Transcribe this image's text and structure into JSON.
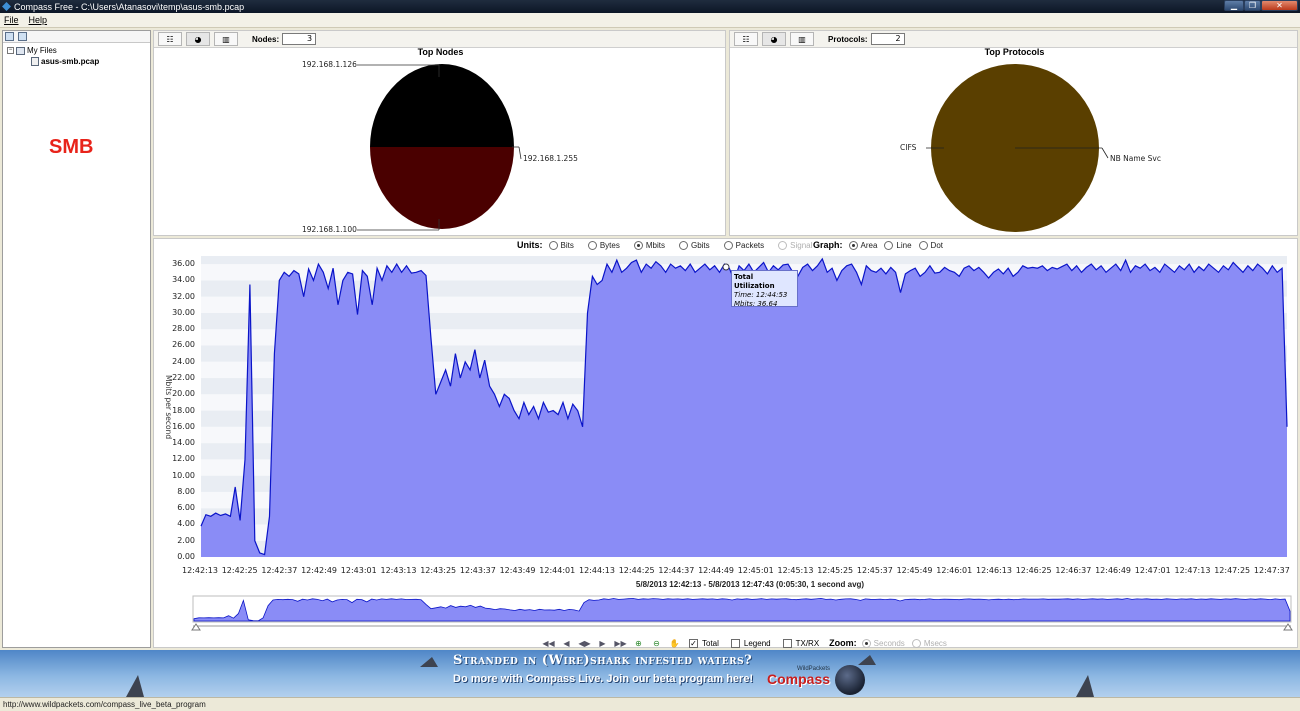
{
  "window": {
    "title": "Compass Free - C:\\Users\\Atanasovi\\temp\\asus-smb.pcap"
  },
  "menu": [
    {
      "label": "File"
    },
    {
      "label": "Help"
    }
  ],
  "tree": {
    "root_label": "My Files",
    "file_label": "asus-smb.pcap",
    "annotation": "SMB"
  },
  "nodes_panel": {
    "count_label": "Nodes:",
    "count_value": "3",
    "title": "Top Nodes",
    "slices": [
      {
        "label": "192.168.1.126",
        "fraction": 0.5,
        "color": "#000000"
      },
      {
        "label": "192.168.1.255",
        "fraction": 0.0,
        "color": "#4a0000"
      },
      {
        "label": "192.168.1.100",
        "fraction": 0.5,
        "color": "#4a0000"
      }
    ]
  },
  "protocols_panel": {
    "count_label": "Protocols:",
    "count_value": "2",
    "title": "Top Protocols",
    "slices": [
      {
        "label": "CIFS",
        "fraction": 1.0,
        "color": "#5a3f00"
      },
      {
        "label": "NB Name Svc",
        "fraction": 0.0,
        "color": "#5a3f00"
      }
    ]
  },
  "units_controls": {
    "label": "Units:",
    "options": [
      {
        "label": "Bits",
        "selected": false,
        "enabled": true
      },
      {
        "label": "Bytes",
        "selected": false,
        "enabled": true
      },
      {
        "label": "Mbits",
        "selected": true,
        "enabled": true
      },
      {
        "label": "Gbits",
        "selected": false,
        "enabled": true
      },
      {
        "label": "Packets",
        "selected": false,
        "enabled": true
      },
      {
        "label": "Signal",
        "selected": false,
        "enabled": false
      }
    ]
  },
  "graph_controls": {
    "label": "Graph:",
    "options": [
      {
        "label": "Area",
        "selected": true
      },
      {
        "label": "Line",
        "selected": false
      },
      {
        "label": "Dot",
        "selected": false
      }
    ]
  },
  "chart_data": {
    "type": "area",
    "ylabel": "Mbits per second",
    "ylim": [
      0,
      37
    ],
    "yticks": [
      "0.00",
      "2.00",
      "4.00",
      "6.00",
      "8.00",
      "10.00",
      "12.00",
      "14.00",
      "16.00",
      "18.00",
      "20.00",
      "22.00",
      "24.00",
      "26.00",
      "28.00",
      "30.00",
      "32.00",
      "34.00",
      "36.00"
    ],
    "xticks": [
      "12:42:13",
      "12:42:25",
      "12:42:37",
      "12:42:49",
      "12:43:01",
      "12:43:13",
      "12:43:25",
      "12:43:37",
      "12:43:49",
      "12:44:01",
      "12:44:13",
      "12:44:25",
      "12:44:37",
      "12:44:49",
      "12:45:01",
      "12:45:13",
      "12:45:25",
      "12:45:37",
      "12:45:49",
      "12:46:01",
      "12:46:13",
      "12:46:25",
      "12:46:37",
      "12:46:49",
      "12:47:01",
      "12:47:13",
      "12:47:25",
      "12:47:37"
    ],
    "grid": true,
    "fill_color": "#8a8cf6",
    "line_color": "#0a14c8",
    "series": [
      {
        "x_start": 0,
        "x_step": 1,
        "values": [
          3.8,
          5.2,
          5.0,
          5.4,
          5.1,
          5.3,
          5.0,
          8.6,
          4.5,
          12.0,
          33.5,
          2.0,
          0.5,
          0.3,
          5.0,
          25.0,
          34.0,
          35.0,
          34.5,
          35.2,
          34.8,
          32.0,
          35.4,
          34.0,
          36.0,
          35.0,
          33.0,
          35.5,
          31.0,
          34.0,
          35.0,
          34.8,
          29.8,
          35.2,
          34.5,
          31.0,
          35.5,
          34.0,
          35.8,
          35.0,
          36.0,
          35.0,
          35.8,
          34.9,
          35.0,
          35.2,
          34.6,
          27.0,
          20.0,
          21.5,
          23.0,
          21.0,
          25.0,
          22.0,
          24.0,
          23.0,
          25.5,
          22.0,
          24.2,
          21.0,
          20.0,
          18.5,
          20.0,
          19.5,
          18.0,
          17.0,
          19.0,
          17.5,
          18.5,
          17.0,
          19.0,
          17.8,
          18.0,
          17.5,
          19.0,
          17.0,
          18.8,
          18.0,
          16.0,
          30.0,
          34.5,
          33.5,
          34.0,
          36.0,
          35.0,
          36.5,
          35.0,
          35.5,
          36.2,
          36.5,
          35.0,
          36.0,
          35.5,
          36.3,
          35.8,
          35.0,
          36.0,
          35.5,
          35.8,
          35.2,
          36.0,
          35.0,
          35.5,
          36.0,
          35.3,
          35.8,
          35.0,
          36.0,
          35.5,
          34.0,
          35.8,
          35.2,
          36.0,
          35.0,
          35.6,
          36.2,
          35.0,
          35.8,
          35.3,
          35.9,
          36.0,
          35.0,
          34.5,
          35.6,
          36.0,
          35.2,
          35.8,
          36.64,
          35.0,
          35.5,
          34.0,
          35.2,
          35.8,
          36.0,
          35.0,
          33.5,
          35.8,
          35.2,
          35.0,
          35.5,
          34.8,
          35.6,
          35.0,
          32.5,
          34.8,
          35.2,
          35.5,
          34.5,
          35.0,
          35.8,
          34.9,
          35.0,
          35.6,
          35.2,
          35.0,
          34.5,
          35.5,
          35.8,
          35.2,
          35.6,
          35.0,
          34.3,
          35.0,
          35.4,
          34.8,
          35.5,
          34.5,
          35.0,
          35.8,
          35.5,
          35.6,
          35.5,
          35.8,
          35.2,
          35.6,
          35.4,
          35.7,
          36.0,
          35.2,
          35.8,
          35.0,
          35.6,
          36.0,
          35.3,
          35.8,
          35.0,
          35.5,
          36.0,
          35.2,
          36.5,
          35.0,
          35.8,
          35.5,
          36.0,
          35.2,
          35.6,
          35.0,
          36.0,
          35.5,
          35.0,
          35.8,
          35.3,
          36.0,
          35.0,
          35.7,
          35.2,
          36.0,
          35.5,
          35.0,
          35.8,
          35.3,
          36.2,
          35.6,
          35.0,
          35.8,
          35.2,
          36.0,
          35.5,
          34.8,
          35.8,
          35.0,
          35.5,
          16.0
        ]
      }
    ],
    "tooltip": {
      "title": "Total Utilization",
      "time": "Time: 12:44:53",
      "value": "Mbits: 36.64"
    },
    "range_label": "5/8/2013 12:42:13 - 5/8/2013 12:47:43  (0:05:30, 1 second avg)"
  },
  "bottom_controls": {
    "total_label": "Total",
    "total_checked": true,
    "legend_label": "Legend",
    "legend_checked": false,
    "txrx_label": "TX/RX",
    "txrx_checked": false,
    "zoom_label": "Zoom:",
    "zoom_options": [
      {
        "label": "Seconds"
      },
      {
        "label": "Msecs"
      }
    ]
  },
  "banner": {
    "headline": "Stranded in (Wire)shark infested waters?",
    "subline": "Do more with Compass Live. Join our beta program here!",
    "brand": "Compass",
    "brand_small": "WildPackets"
  },
  "status": {
    "text": "http://www.wildpackets.com/compass_live_beta_program"
  }
}
